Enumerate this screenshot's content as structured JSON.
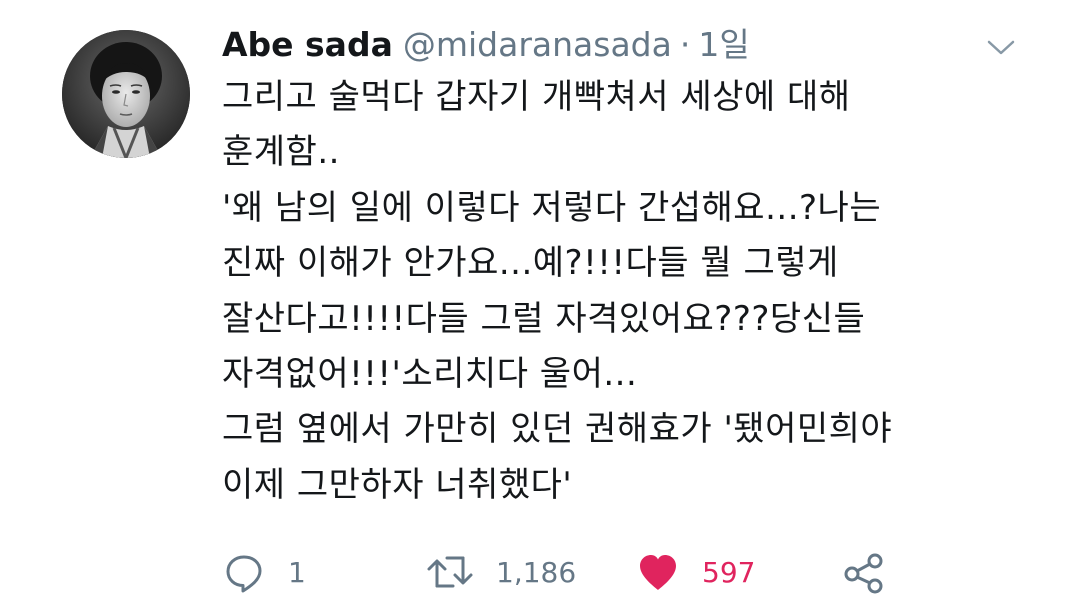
{
  "author": {
    "display_name": "Abe sada",
    "handle": "@midaranasada",
    "separator": "·",
    "time": "1일"
  },
  "tweet": {
    "lines": [
      "그리고 술먹다 갑자기 개빡쳐서 세상에 대해",
      "훈계함..",
      "'왜 남의 일에 이렇다 저렇다 간섭해요...?나는",
      "진짜 이해가 안가요...예?!!!다들 뭘 그렇게",
      "잘산다고!!!!다들 그럴 자격있어요???당신들",
      "자격없어!!!'소리치다 울어...",
      "그럼 옆에서 가만히 있던 권해효가 '됐어민희야",
      "이제 그만하자 너취했다'"
    ]
  },
  "actions": {
    "reply_count": "1",
    "retweet_count": "1,186",
    "like_count": "597",
    "reply_icon": "reply-icon",
    "retweet_icon": "retweet-icon",
    "like_icon": "heart-icon",
    "share_icon": "share-icon"
  },
  "colors": {
    "text": "#14171a",
    "secondary": "#657786",
    "like": "#e0245e"
  }
}
